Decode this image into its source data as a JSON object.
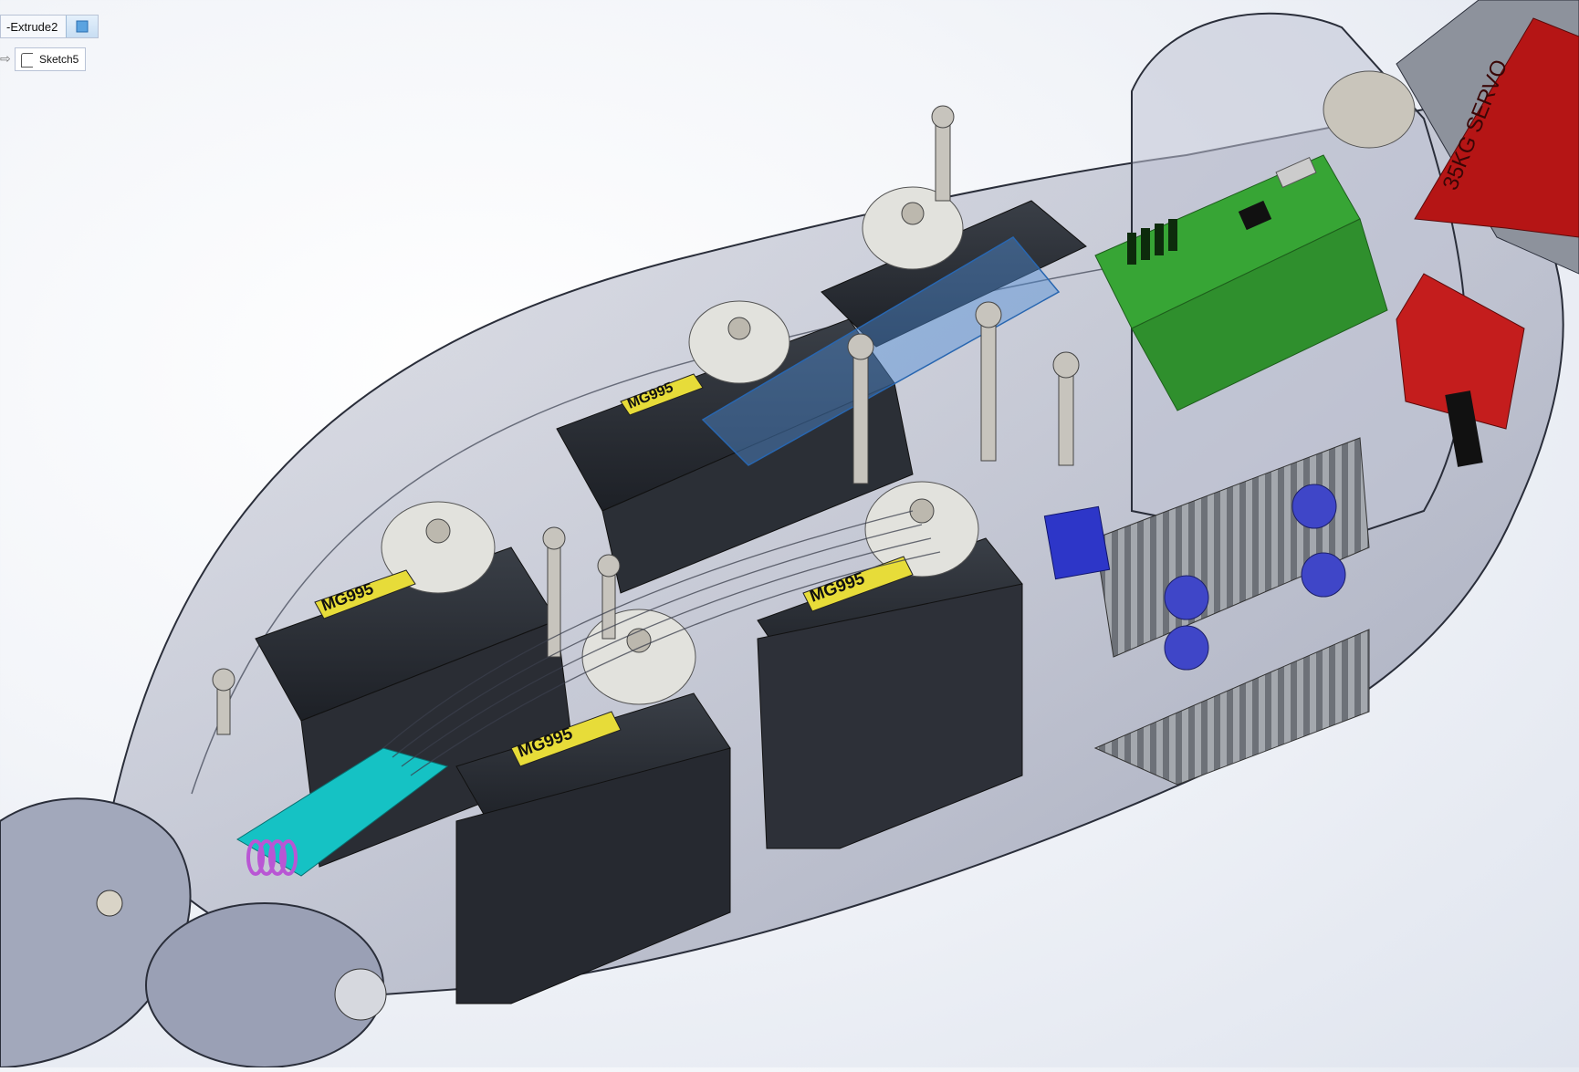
{
  "feature_tree": {
    "extrude_label": "-Extrude2",
    "sketch_label": "Sketch5",
    "arrow_glyph": "⇨"
  },
  "model": {
    "servo_marking": "MG995",
    "big_servo_label": "35KG SERVO"
  },
  "colors": {
    "body": "#8d94a8",
    "servo": "#23272e",
    "pcb_green": "#37a535",
    "driver_red": "#c41d1d",
    "big_servo_red": "#b51515",
    "heatsink": "#7c8087",
    "capacitor": "#3f46c8",
    "cyan_part": "#15c2c4",
    "select_blue": "#4f8fd6",
    "label_yellow": "#e7dc39"
  }
}
